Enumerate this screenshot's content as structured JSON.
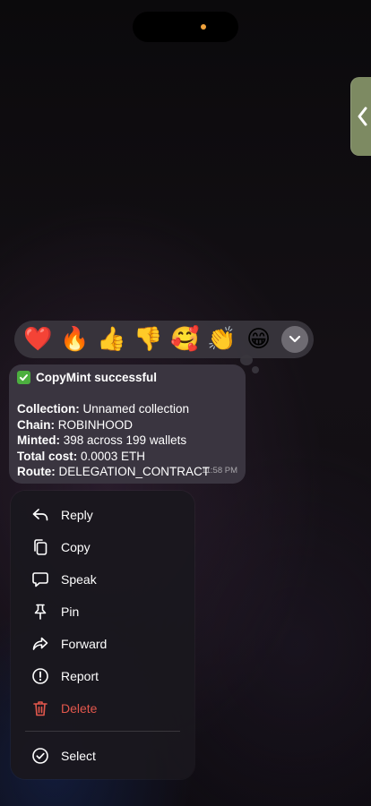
{
  "reactions": [
    "❤️",
    "🔥",
    "👍",
    "👎",
    "🥰",
    "👏",
    "😁"
  ],
  "message": {
    "title": "CopyMint successful",
    "lines": [
      {
        "label": "Collection:",
        "value": " Unnamed collection"
      },
      {
        "label": "Chain:",
        "value": " ROBINHOOD"
      },
      {
        "label": "Minted:",
        "value": " 398 across 199 wallets"
      },
      {
        "label": "Total cost:",
        "value": " 0.0003 ETH"
      },
      {
        "label": "Route:",
        "value": " DELEGATION_CONTRACT"
      }
    ],
    "time": "11:58 PM"
  },
  "menu": {
    "reply": "Reply",
    "copy": "Copy",
    "speak": "Speak",
    "pin": "Pin",
    "forward": "Forward",
    "report": "Report",
    "delete": "Delete",
    "select": "Select"
  },
  "colors": {
    "danger": "#e2574c",
    "bubble": "#3a3540",
    "accent_dot": "#f0a23c"
  }
}
